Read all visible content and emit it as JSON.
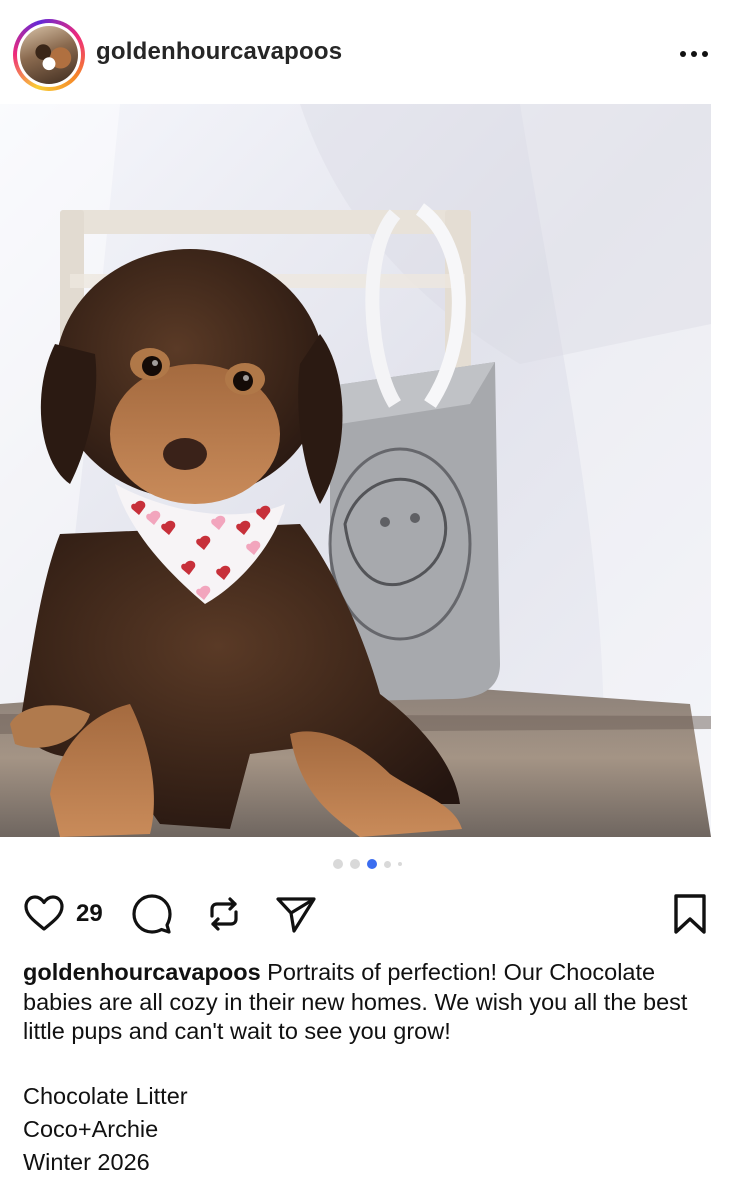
{
  "post": {
    "username": "goldenhourcavapoos",
    "likes": "29",
    "caption_text": "Portraits of perfection! Our Chocolate babies are all cozy in their new homes. We wish you all the best little pups and can't wait to see you grow!",
    "caption_lines": [
      "Chocolate Litter",
      "Coco+Archie",
      "Winter 2026"
    ],
    "carousel": {
      "total": 5,
      "active_index": 3
    }
  },
  "icons": {
    "avatar": "profile-avatar",
    "more": "more-options-icon",
    "like": "heart-icon",
    "comment": "comment-icon",
    "repost": "repost-icon",
    "share": "send-icon",
    "save": "bookmark-icon"
  },
  "colors": {
    "text": "#111111",
    "active_dot": "#3b6df0",
    "inactive_dot": "#d9d9d9"
  }
}
